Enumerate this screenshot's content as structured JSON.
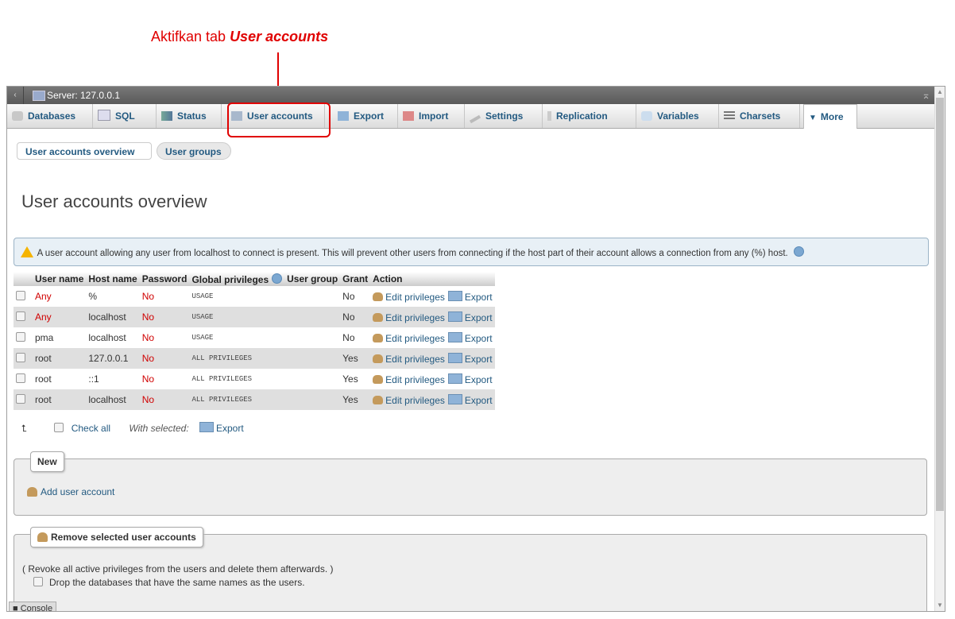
{
  "annotation": {
    "prefix": "Aktifkan tab ",
    "emph": "User accounts"
  },
  "server": {
    "title": "Server: 127.0.0.1"
  },
  "tabs": [
    {
      "label": "Databases"
    },
    {
      "label": "SQL"
    },
    {
      "label": "Status"
    },
    {
      "label": "User accounts"
    },
    {
      "label": "Export"
    },
    {
      "label": "Import"
    },
    {
      "label": "Settings"
    },
    {
      "label": "Replication"
    },
    {
      "label": "Variables"
    },
    {
      "label": "Charsets"
    },
    {
      "label": "More"
    }
  ],
  "subtabs": [
    {
      "label": "User accounts overview"
    },
    {
      "label": "User groups"
    }
  ],
  "page_title": "User accounts overview",
  "notice": "A user account allowing any user from localhost to connect is present. This will prevent other users from connecting if the host part of their account allows a connection from any (%) host.",
  "table": {
    "headers": [
      "User name",
      "Host name",
      "Password",
      "Global privileges",
      "User group",
      "Grant",
      "Action"
    ],
    "rows": [
      {
        "user": "Any",
        "host": "%",
        "password": "No",
        "privileges": "USAGE",
        "group": "",
        "grant": "No"
      },
      {
        "user": "Any",
        "host": "localhost",
        "password": "No",
        "privileges": "USAGE",
        "group": "",
        "grant": "No"
      },
      {
        "user": "pma",
        "host": "localhost",
        "password": "No",
        "privileges": "USAGE",
        "group": "",
        "grant": "No"
      },
      {
        "user": "root",
        "host": "127.0.0.1",
        "password": "No",
        "privileges": "ALL PRIVILEGES",
        "group": "",
        "grant": "Yes"
      },
      {
        "user": "root",
        "host": "::1",
        "password": "No",
        "privileges": "ALL PRIVILEGES",
        "group": "",
        "grant": "Yes"
      },
      {
        "user": "root",
        "host": "localhost",
        "password": "No",
        "privileges": "ALL PRIVILEGES",
        "group": "",
        "grant": "Yes"
      }
    ],
    "edit_label": "Edit privileges",
    "export_label": "Export"
  },
  "footer": {
    "check_all": "Check all",
    "with_selected": "With selected:",
    "export": "Export"
  },
  "new_box": {
    "legend": "New",
    "add_user": "Add user account"
  },
  "remove_box": {
    "legend": "Remove selected user accounts",
    "description": "( Revoke all active privileges from the users and delete them afterwards. )",
    "drop_db": "Drop the databases that have the same names as the users."
  },
  "console": {
    "label": "Console"
  },
  "colors": {
    "annotation": "#e00000",
    "link": "#235a81",
    "anonymous_user": "#d00000"
  }
}
